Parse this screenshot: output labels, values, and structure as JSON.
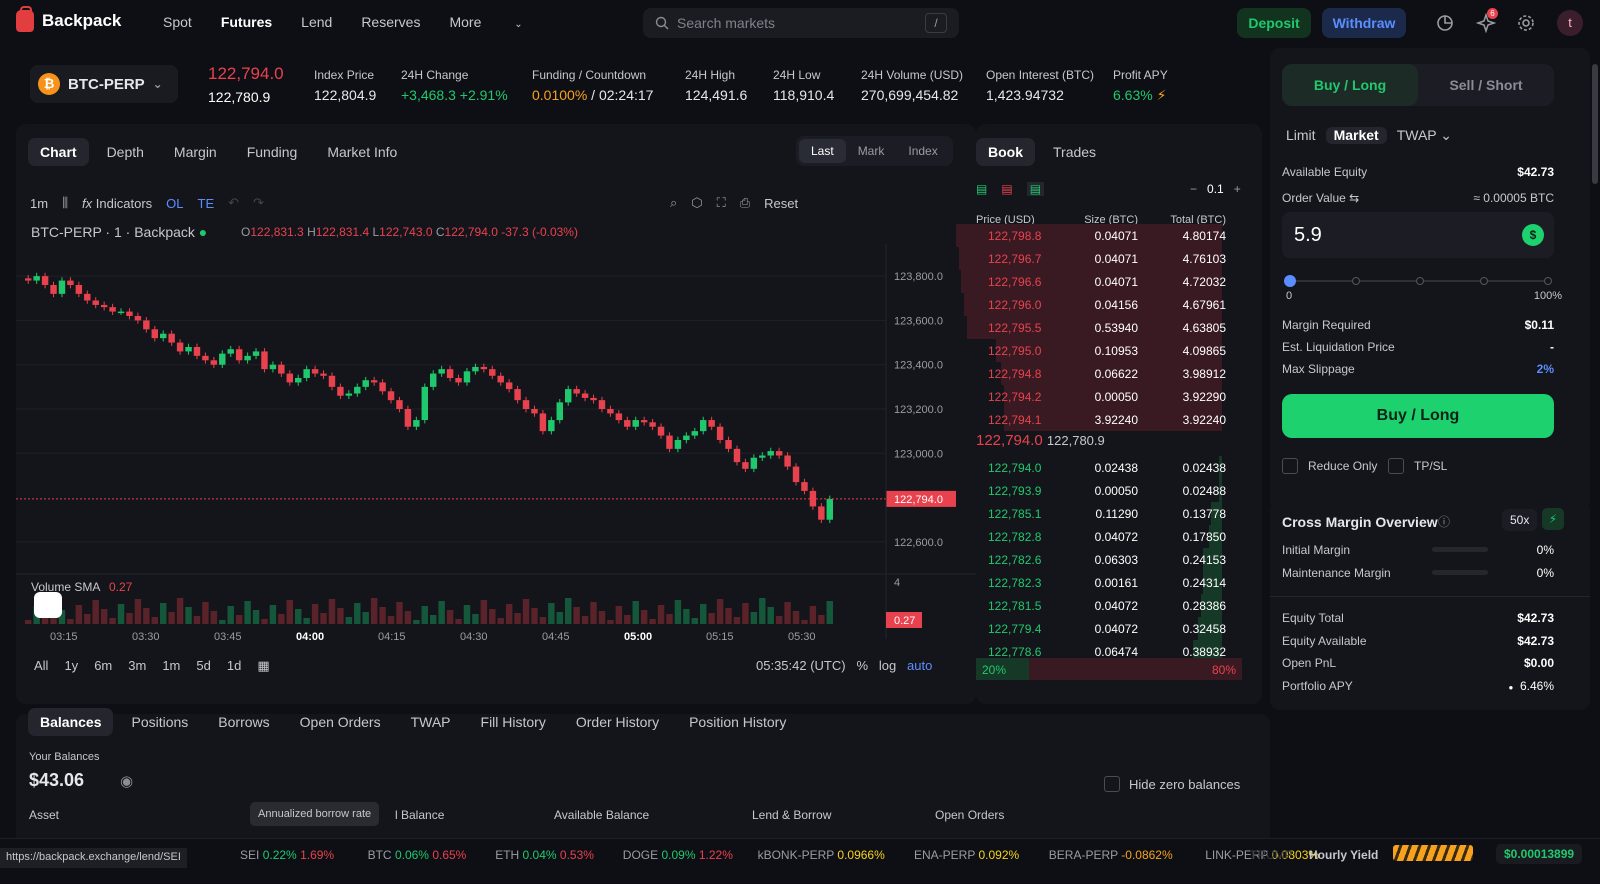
{
  "nav": {
    "brand": "Backpack",
    "links": [
      "Spot",
      "Futures",
      "Lend",
      "Reserves",
      "More"
    ],
    "active": "Futures",
    "search_placeholder": "Search markets",
    "search_kbd": "/",
    "deposit": "Deposit",
    "withdraw": "Withdraw",
    "notif_count": "6",
    "avatar": "t"
  },
  "ticker": {
    "market": "BTC-PERP",
    "last": "122,794.0",
    "mark": "122,780.9",
    "stats": [
      {
        "label": "Index Price",
        "value": "122,804.9"
      },
      {
        "label": "24H Change",
        "value": "+3,468.3 +2.91%"
      },
      {
        "label": "Funding / Countdown",
        "value_a": "0.0100%",
        "value_b": "/ 02:24:17"
      },
      {
        "label": "24H High",
        "value": "124,491.6"
      },
      {
        "label": "24H Low",
        "value": "118,910.4"
      },
      {
        "label": "24H Volume (USD)",
        "value": "270,699,454.82"
      },
      {
        "label": "Open Interest (BTC)",
        "value": "1,423.94732"
      },
      {
        "label": "Profit APY",
        "value": "6.63%"
      }
    ]
  },
  "chart": {
    "tabs": [
      "Chart",
      "Depth",
      "Margin",
      "Funding",
      "Market Info"
    ],
    "price_type": [
      "Last",
      "Mark",
      "Index"
    ],
    "interval": "1m",
    "indicators": "Indicators",
    "ol": "OL",
    "te": "TE",
    "reset": "Reset",
    "symbol": "BTC-PERP · 1 · Backpack",
    "ohlc": {
      "o": "122,831.3",
      "h": "122,831.4",
      "l": "122,743.0",
      "c": "122,794.0",
      "chg": "-37.3 (-0.03%)"
    },
    "price_ticks": [
      "123,800.0",
      "123,600.0",
      "123,400.0",
      "123,200.0",
      "123,000.0",
      "122,600.0"
    ],
    "price_label": "122,794.0",
    "volume_label": "Volume SMA",
    "volume_val": "0.27",
    "vol_tick": "4",
    "vol_tag": "0.27",
    "time_ticks": [
      "03:15",
      "03:30",
      "03:45",
      "04:00",
      "04:15",
      "04:30",
      "04:45",
      "05:00",
      "05:15",
      "05:30"
    ],
    "ranges": [
      "All",
      "1y",
      "6m",
      "3m",
      "1m",
      "5d",
      "1d"
    ],
    "clock": "05:35:42 (UTC)",
    "pct": "%",
    "log": "log",
    "auto": "auto"
  },
  "chart_data": {
    "type": "candlestick",
    "title": "BTC-PERP · 1 · Backpack",
    "ylim": [
      122500,
      123900
    ],
    "yticks": [
      123800,
      123600,
      123400,
      123200,
      123000,
      122600
    ],
    "xticks": [
      "03:15",
      "03:30",
      "03:45",
      "04:00",
      "04:15",
      "04:30",
      "04:45",
      "05:00",
      "05:15",
      "05:30"
    ],
    "close": [
      123780,
      123800,
      123760,
      123720,
      123780,
      123760,
      123720,
      123690,
      123670,
      123660,
      123640,
      123640,
      123620,
      123600,
      123560,
      123520,
      123540,
      123500,
      123460,
      123480,
      123440,
      123420,
      123400,
      123450,
      123470,
      123420,
      123440,
      123460,
      123380,
      123400,
      123360,
      123320,
      123340,
      123380,
      123360,
      123350,
      123300,
      123260,
      123270,
      123300,
      123330,
      123320,
      123280,
      123240,
      123200,
      123120,
      123150,
      123300,
      123360,
      123380,
      123340,
      123320,
      123370,
      123390,
      123380,
      123350,
      123320,
      123290,
      123240,
      123200,
      123180,
      123100,
      123150,
      123230,
      123290,
      123270,
      123250,
      123240,
      123200,
      123180,
      123150,
      123120,
      123150,
      123140,
      123120,
      123080,
      123020,
      123060,
      123080,
      123100,
      123150,
      123120,
      123060,
      123020,
      122960,
      122930,
      122980,
      122990,
      123010,
      122990,
      122940,
      122870,
      122830,
      122760,
      122700,
      122794
    ]
  },
  "book": {
    "tabs": [
      "Book",
      "Trades"
    ],
    "step": "0.1",
    "headers": [
      "Price (USD)",
      "Size (BTC)",
      "Total (BTC)"
    ],
    "asks": [
      [
        "122,798.8",
        "0.04071",
        "4.80174"
      ],
      [
        "122,796.7",
        "0.04071",
        "4.76103"
      ],
      [
        "122,796.6",
        "0.04071",
        "4.72032"
      ],
      [
        "122,796.0",
        "0.04156",
        "4.67961"
      ],
      [
        "122,795.5",
        "0.53940",
        "4.63805"
      ],
      [
        "122,795.0",
        "0.10953",
        "4.09865"
      ],
      [
        "122,794.8",
        "0.06622",
        "3.98912"
      ],
      [
        "122,794.2",
        "0.00050",
        "3.92290"
      ],
      [
        "122,794.1",
        "3.92240",
        "3.92240"
      ]
    ],
    "ask_depth": [
      1.0,
      0.99,
      0.98,
      0.97,
      0.96,
      0.85,
      0.83,
      0.82,
      0.82
    ],
    "mid": "122,794.0",
    "mid_mark": "122,780.9",
    "bids": [
      [
        "122,794.0",
        "0.02438",
        "0.02438"
      ],
      [
        "122,793.9",
        "0.00050",
        "0.02488"
      ],
      [
        "122,785.1",
        "0.11290",
        "0.13778"
      ],
      [
        "122,782.8",
        "0.04072",
        "0.17850"
      ],
      [
        "122,782.6",
        "0.06303",
        "0.24153"
      ],
      [
        "122,782.3",
        "0.00161",
        "0.24314"
      ],
      [
        "122,781.5",
        "0.04072",
        "0.28386"
      ],
      [
        "122,779.4",
        "0.04072",
        "0.32458"
      ],
      [
        "122,778.6",
        "0.06474",
        "0.38932"
      ]
    ],
    "bid_depth": [
      0.01,
      0.01,
      0.04,
      0.05,
      0.07,
      0.07,
      0.08,
      0.09,
      0.11
    ],
    "buy_pct": "20%",
    "sell_pct": "80%",
    "buy_frac": 0.2
  },
  "order": {
    "buy": "Buy / Long",
    "sell": "Sell / Short",
    "types": [
      "Limit",
      "Market",
      "TWAP"
    ],
    "active_type": "Market",
    "available_equity_label": "Available Equity",
    "available_equity": "$42.73",
    "order_value_label": "Order Value",
    "order_value_conv": "≈ 0.00005 BTC",
    "amount": "5.9",
    "slider_min": "0",
    "slider_max": "100%",
    "slider_level": 0,
    "margin_required_label": "Margin Required",
    "margin_required": "$0.11",
    "liq_label": "Est. Liquidation Price",
    "liq": "-",
    "slippage_label": "Max Slippage",
    "slippage": "2%",
    "submit": "Buy / Long",
    "reduce_only": "Reduce Only",
    "tpsl": "TP/SL"
  },
  "overview": {
    "title": "Cross Margin Overview",
    "leverage": "50x",
    "initial_margin_label": "Initial Margin",
    "initial_margin": "0%",
    "maint_margin_label": "Maintenance Margin",
    "maint_margin": "0%",
    "equity_total_label": "Equity Total",
    "equity_total": "$42.73",
    "equity_available_label": "Equity Available",
    "equity_available": "$42.73",
    "open_pnl_label": "Open PnL",
    "open_pnl": "$0.00",
    "portfolio_apy_label": "Portfolio APY",
    "portfolio_apy": "6.46%"
  },
  "bottom": {
    "tabs": [
      "Balances",
      "Positions",
      "Borrows",
      "Open Orders",
      "TWAP",
      "Fill History",
      "Order History",
      "Position History"
    ],
    "your_balances": "Your Balances",
    "total": "$43.06",
    "hide_zero": "Hide zero balances",
    "cols": [
      "Asset",
      "l Balance",
      "Available Balance",
      "Lend & Borrow",
      "Open Orders"
    ],
    "tooltip": "Annualized borrow rate"
  },
  "footer": {
    "url": "https://backpack.exchange/lend/SEI",
    "items": [
      [
        "SEI",
        "0.22%",
        "1.69%"
      ],
      [
        "BTC",
        "0.06%",
        "0.65%"
      ],
      [
        "ETH",
        "0.04%",
        "0.53%"
      ],
      [
        "DOGE",
        "0.09%",
        "1.22%"
      ],
      [
        "kBONK-PERP",
        "0.0966%",
        ""
      ],
      [
        "ENA-PERP",
        "0.092%",
        ""
      ],
      [
        "BERA-PERP",
        "-0.0862%",
        ""
      ],
      [
        "LINK-PERP",
        "0.0803%",
        ""
      ]
    ],
    "trump": "TRUMP",
    "hourly_label": "Hourly Yield",
    "hourly": "$0.00013899"
  }
}
